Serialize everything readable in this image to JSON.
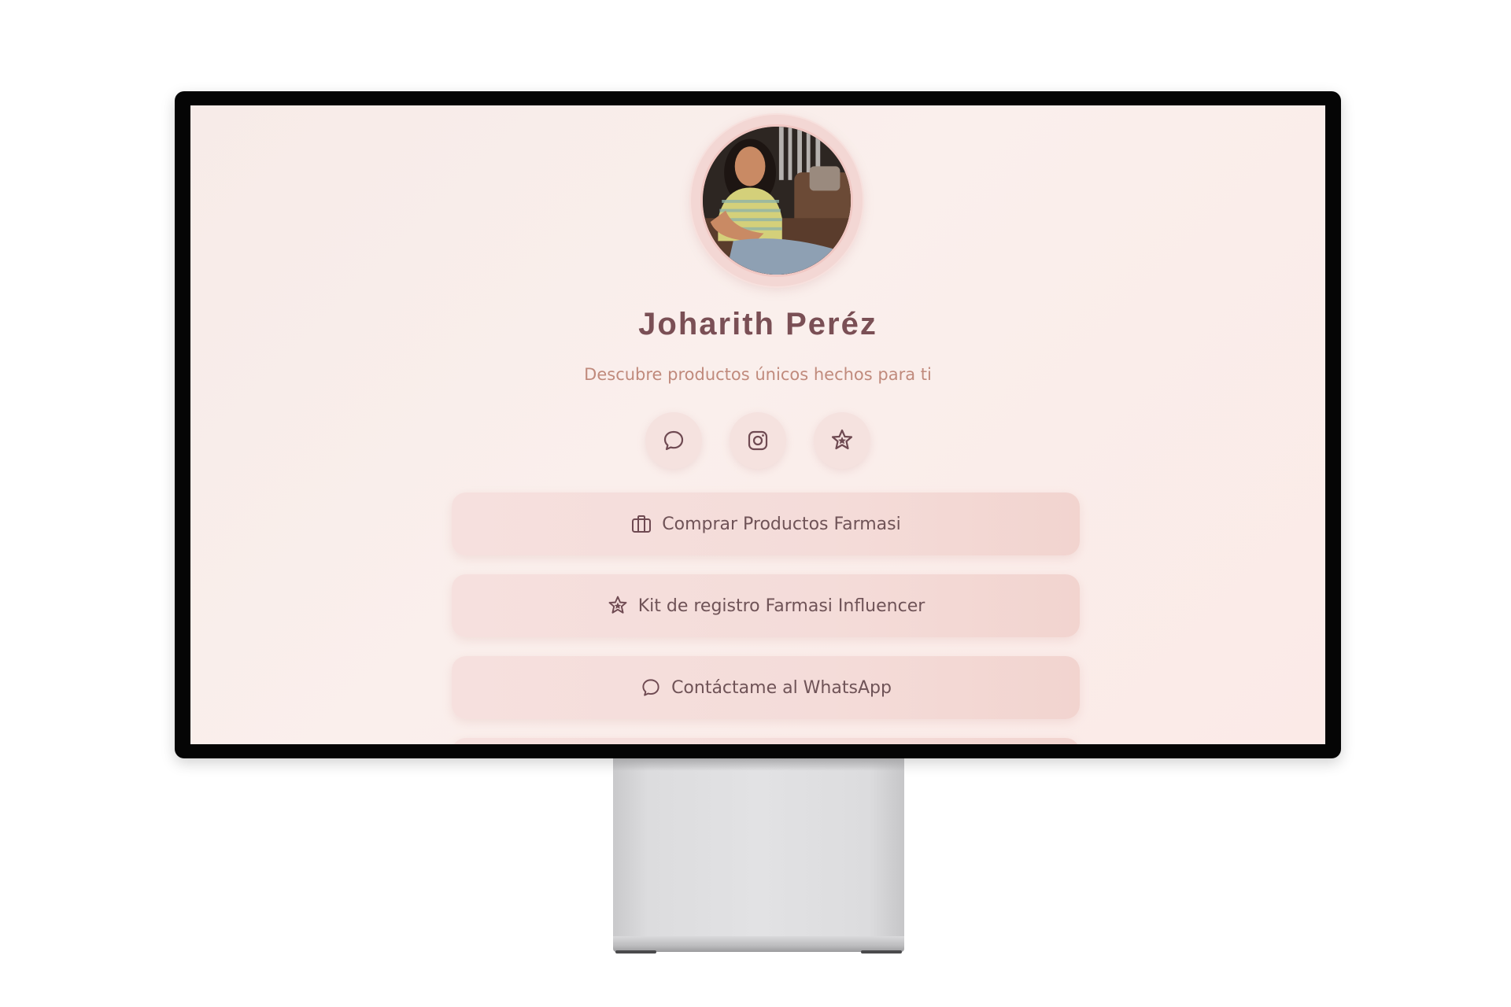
{
  "profile": {
    "name": "Joharith Peréz",
    "tagline": "Descubre productos únicos hechos para ti"
  },
  "socials": [
    {
      "icon": "whatsapp-icon"
    },
    {
      "icon": "instagram-icon"
    },
    {
      "icon": "star-badge-icon"
    }
  ],
  "links": [
    {
      "label": "Comprar Productos Farmasi",
      "icon": "shopping-bag-icon"
    },
    {
      "label": "Kit de registro Farmasi Influencer",
      "icon": "star-badge-icon"
    },
    {
      "label": "Contáctame al WhatsApp",
      "icon": "whatsapp-icon"
    }
  ],
  "colors": {
    "accent": "#7a4f55",
    "tagline": "#c08a7c",
    "button": "#f4dcd9",
    "background": "#f9ece9"
  }
}
